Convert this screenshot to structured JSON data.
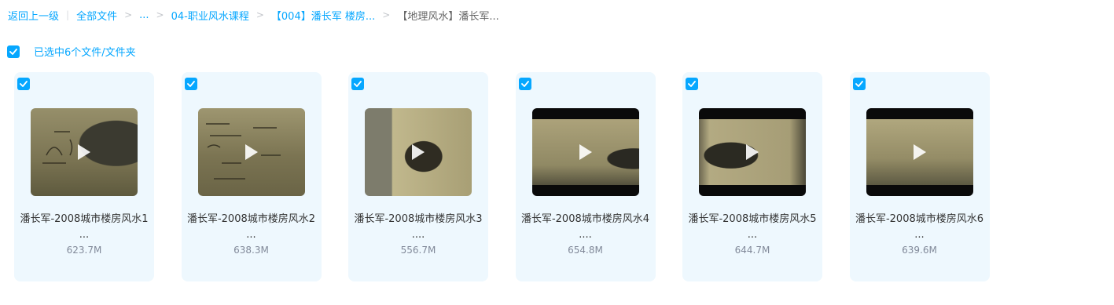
{
  "breadcrumb": {
    "back": "返回上一级",
    "root": "全部文件",
    "ellipsis": "...",
    "level1": "04-职业风水课程",
    "level2": "【004】潘长军 楼房...",
    "current": "【地理风水】潘长军...",
    "separator": ">",
    "divider": "|"
  },
  "selection": {
    "label": "已选中6个文件/文件夹",
    "checked": true,
    "icon": "check-icon"
  },
  "files": [
    {
      "name": "潘长军-2008城市楼房风水1 ...",
      "size": "623.7M",
      "checked": true
    },
    {
      "name": "潘长军-2008城市楼房风水2 ...",
      "size": "638.3M",
      "checked": true
    },
    {
      "name": "潘长军-2008城市楼房风水3 ....",
      "size": "556.7M",
      "checked": true
    },
    {
      "name": "潘长军-2008城市楼房风水4 ....",
      "size": "654.8M",
      "checked": true
    },
    {
      "name": "潘长军-2008城市楼房风水5 ...",
      "size": "644.7M",
      "checked": true
    },
    {
      "name": "潘长军-2008城市楼房风水6 ...",
      "size": "639.6M",
      "checked": true
    }
  ],
  "colors": {
    "accent": "#06a7ff",
    "card_bg": "#eef8fe",
    "size_text": "#818999"
  }
}
